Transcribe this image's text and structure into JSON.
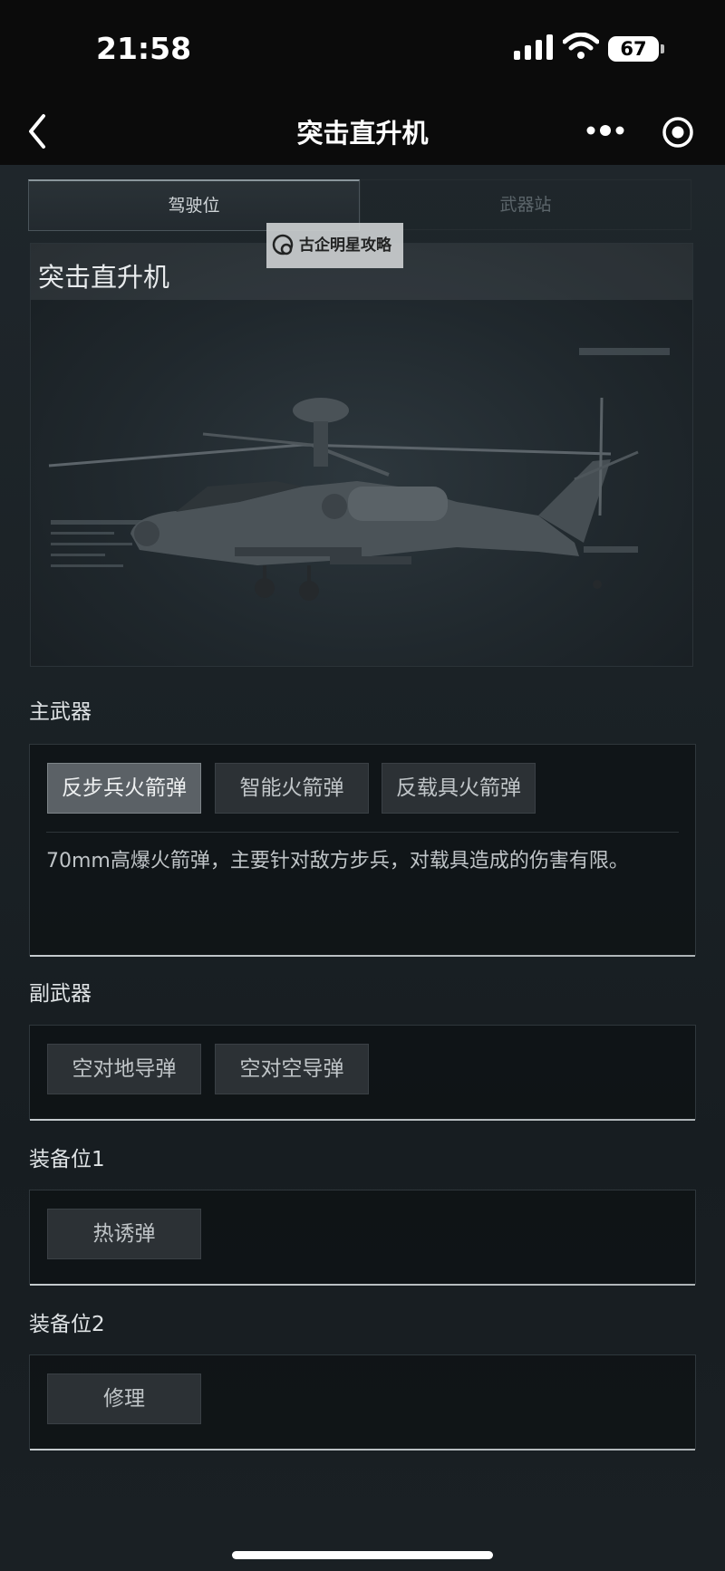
{
  "status": {
    "time": "21:58",
    "battery": "67"
  },
  "nav": {
    "title": "突击直升机"
  },
  "tabs": [
    {
      "label": "驾驶位",
      "active": true
    },
    {
      "label": "武器站",
      "active": false
    }
  ],
  "hero": {
    "title": "突击直升机",
    "watermark": "古企明星攻略"
  },
  "sections": {
    "primary": {
      "label": "主武器",
      "options": [
        "反步兵火箭弹",
        "智能火箭弹",
        "反载具火箭弹"
      ],
      "selected": "反步兵火箭弹",
      "description": "70mm高爆火箭弹，主要针对敌方步兵，对载具造成的伤害有限。"
    },
    "secondary": {
      "label": "副武器",
      "options": [
        "空对地导弹",
        "空对空导弹"
      ]
    },
    "equip1": {
      "label": "装备位1",
      "options": [
        "热诱弹"
      ]
    },
    "equip2": {
      "label": "装备位2",
      "options": [
        "修理"
      ]
    }
  },
  "colors": {
    "background": "#1b2226",
    "chip_selected": "#5b6166",
    "chip": "#2c3135"
  }
}
